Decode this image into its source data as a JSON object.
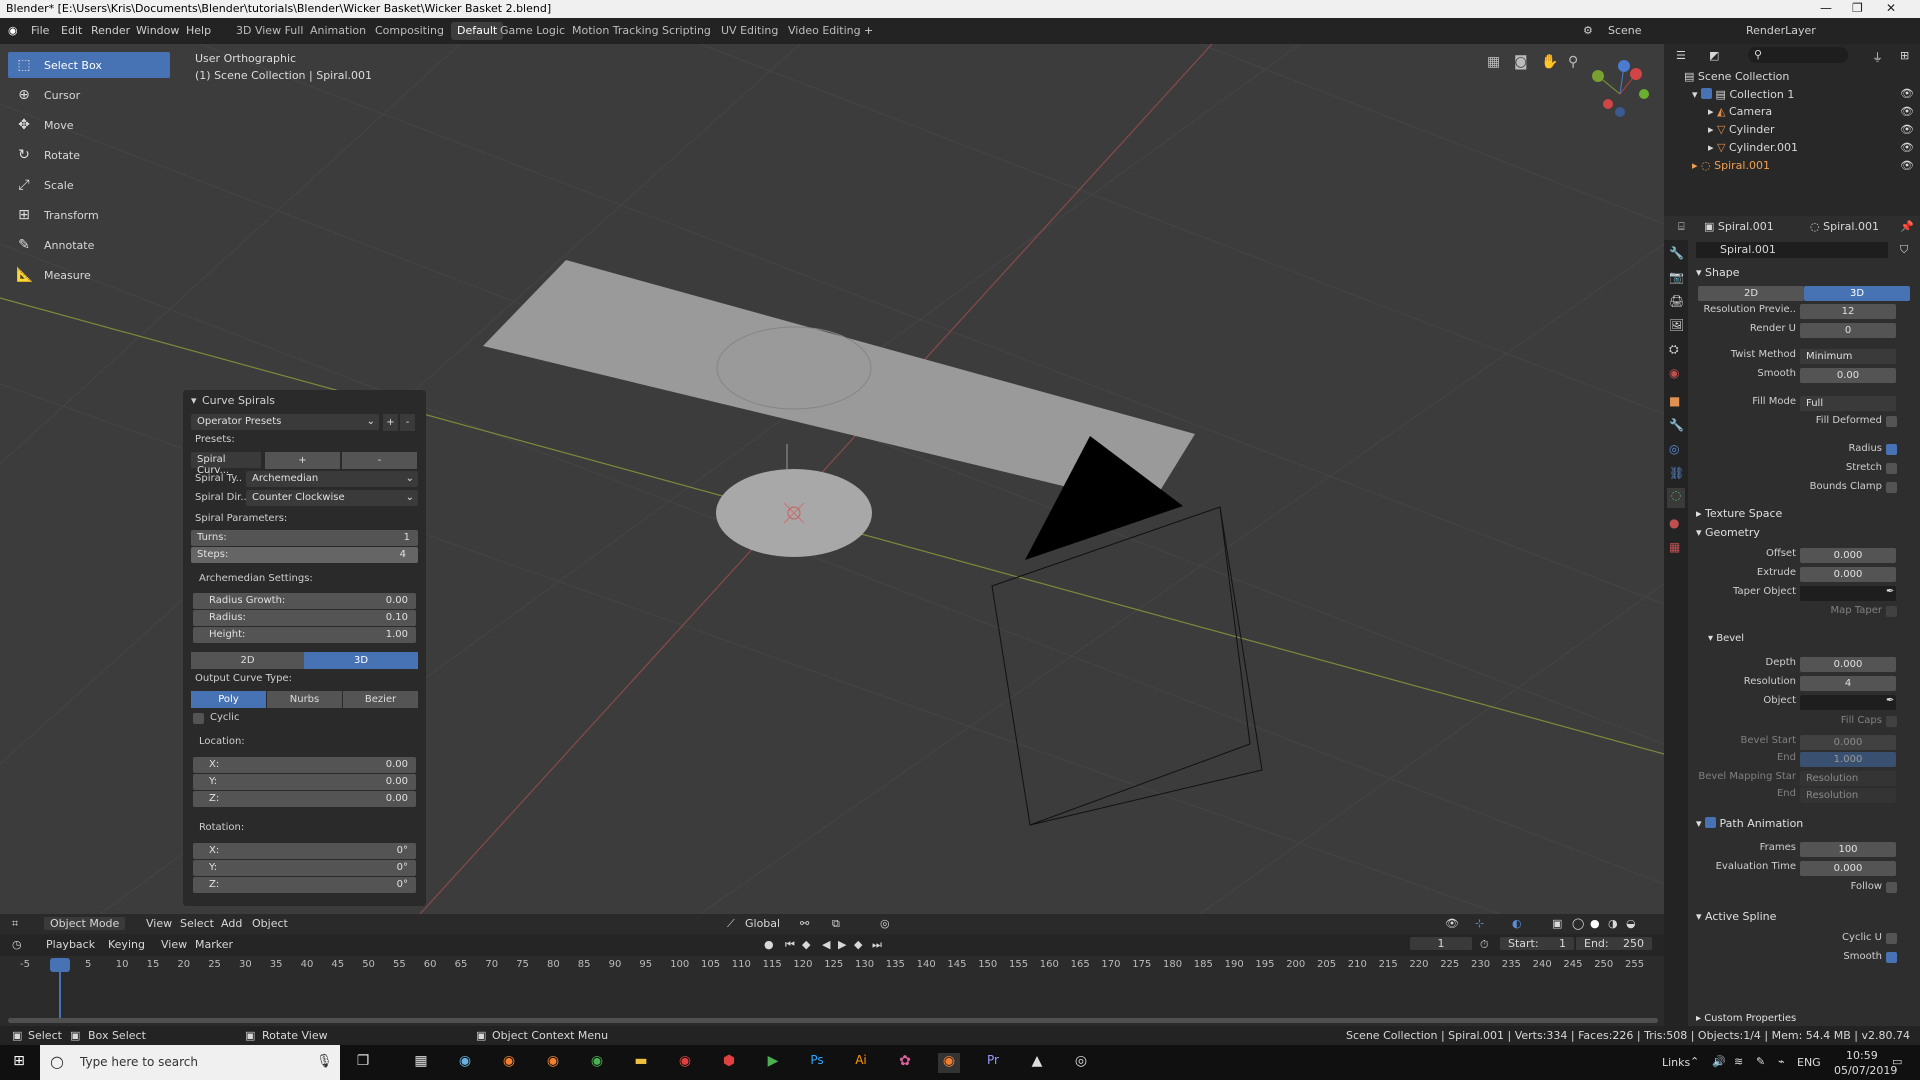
{
  "title_bar": {
    "text": "Blender* [E:\\Users\\Kris\\Documents\\Blender\\tutorials\\Blender\\Wicker Basket\\Wicker Basket 2.blend]"
  },
  "menu": [
    "File",
    "Edit",
    "Render",
    "Window",
    "Help"
  ],
  "workspaces": [
    "3D View Full",
    "Animation",
    "Compositing",
    "Default",
    "Game Logic",
    "Motion Tracking",
    "Scripting",
    "UV Editing",
    "Video Editing"
  ],
  "active_workspace": "Default",
  "scene_name": "Scene",
  "render_layer": "RenderLayer",
  "viewport": {
    "view_name": "User Orthographic",
    "collection_info": "(1) Scene Collection | Spiral.001"
  },
  "tools": [
    "Select Box",
    "Cursor",
    "Move",
    "Rotate",
    "Scale",
    "Transform",
    "Annotate",
    "Measure"
  ],
  "operator_panel": {
    "title": "Curve Spirals",
    "operator_presets": "Operator Presets",
    "presets_label": "Presets:",
    "spiral_curve": "Spiral Curv...",
    "plus": "+",
    "minus": "-",
    "spiral_type_label": "Spiral Ty..",
    "spiral_type": "Archemedian",
    "spiral_dir_label": "Spiral Dir..",
    "spiral_dir": "Counter Clockwise",
    "spiral_params": "Spiral Parameters:",
    "turns_label": "Turns:",
    "turns": "1",
    "steps_label": "Steps:",
    "steps": "4",
    "arch_settings": "Archemedian Settings:",
    "radius_growth_label": "Radius Growth:",
    "radius_growth": "0.00",
    "radius_label": "Radius:",
    "radius": "0.10",
    "height_label": "Height:",
    "height": "1.00",
    "dim_2d": "2D",
    "dim_3d": "3D",
    "output_type_label": "Output Curve Type:",
    "types": [
      "Poly",
      "Nurbs",
      "Bezier"
    ],
    "cyclic": "Cyclic",
    "location_label": "Location:",
    "loc_x_label": "X:",
    "loc_x": "0.00",
    "loc_y_label": "Y:",
    "loc_y": "0.00",
    "loc_z_label": "Z:",
    "loc_z": "0.00",
    "rotation_label": "Rotation:",
    "rot_x_label": "X:",
    "rot_x": "0°",
    "rot_y_label": "Y:",
    "rot_y": "0°",
    "rot_z_label": "Z:",
    "rot_z": "0°"
  },
  "viewport_header": {
    "mode": "Object Mode",
    "view": "View",
    "select": "Select",
    "add": "Add",
    "object": "Object",
    "orientation": "Global"
  },
  "timeline_header": {
    "playback": "Playback",
    "keying": "Keying",
    "view": "View",
    "marker": "Marker",
    "current_frame": "1",
    "start_label": "Start:",
    "start": "1",
    "end_label": "End:",
    "end": "250"
  },
  "timeline_ticks": [
    "-5",
    "1",
    "5",
    "10",
    "15",
    "20",
    "25",
    "30",
    "35",
    "40",
    "45",
    "50",
    "55",
    "60",
    "65",
    "70",
    "75",
    "80",
    "85",
    "90",
    "95",
    "100",
    "105",
    "110",
    "115",
    "120",
    "125",
    "130",
    "135",
    "140",
    "145",
    "150",
    "155",
    "160",
    "165",
    "170",
    "175",
    "180",
    "185",
    "190",
    "195",
    "200",
    "205",
    "210",
    "215",
    "220",
    "225",
    "230",
    "235",
    "240",
    "245",
    "250",
    "255"
  ],
  "status_bar": {
    "select": "Select",
    "box_select": "Box Select",
    "rotate_view": "Rotate View",
    "context_menu": "Object Context Menu",
    "stats": "Scene Collection | Spiral.001 | Verts:334 | Faces:226 | Tris:508 | Objects:1/4 | Mem: 54.4 MB | v2.80.74"
  },
  "outliner": {
    "root": "Scene Collection",
    "collection": "Collection 1",
    "items": [
      "Camera",
      "Cylinder",
      "Cylinder.001",
      "Spiral.001"
    ]
  },
  "properties": {
    "object_name": "Spiral.001",
    "data_name": "Spiral.001",
    "datablock": "Spiral.001",
    "shape": "Shape",
    "dim_2d": "2D",
    "dim_3d": "3D",
    "resolution_preview_label": "Resolution Previe..",
    "resolution_preview": "12",
    "render_u_label": "Render U",
    "render_u": "0",
    "twist_method_label": "Twist Method",
    "twist_method": "Minimum",
    "smooth_label": "Smooth",
    "smooth": "0.00",
    "fill_mode_label": "Fill Mode",
    "fill_mode": "Full",
    "fill_deformed": "Fill Deformed",
    "radius": "Radius",
    "stretch": "Stretch",
    "bounds_clamp": "Bounds Clamp",
    "texture_space": "Texture Space",
    "geometry": "Geometry",
    "offset_label": "Offset",
    "offset": "0.000",
    "extrude_label": "Extrude",
    "extrude": "0.000",
    "taper_object": "Taper Object",
    "map_taper": "Map Taper",
    "bevel": "Bevel",
    "depth_label": "Depth",
    "depth": "0.000",
    "resolution_label": "Resolution",
    "resolution": "4",
    "object_label": "Object",
    "fill_caps": "Fill Caps",
    "bevel_start_label": "Bevel Start",
    "bevel_start": "0.000",
    "end_label": "End",
    "end": "1.000",
    "bevel_mapping_label": "Bevel Mapping Star",
    "bevel_mapping": "Resolution",
    "end2_label": "End",
    "end2": "Resolution",
    "path_animation": "Path Animation",
    "frames_label": "Frames",
    "frames": "100",
    "eval_time_label": "Evaluation Time",
    "eval_time": "0.000",
    "follow": "Follow",
    "active_spline": "Active Spline",
    "cyclic_u": "Cyclic U",
    "smooth2": "Smooth",
    "custom_props": "Custom Properties"
  },
  "taskbar": {
    "search": "Type here to search",
    "links": "Links",
    "lang": "ENG",
    "time": "10:59",
    "date": "05/07/2019"
  },
  "colors": {
    "accent": "#4772b3",
    "bg": "#3d3d3d",
    "panel": "#2a2a2a"
  }
}
